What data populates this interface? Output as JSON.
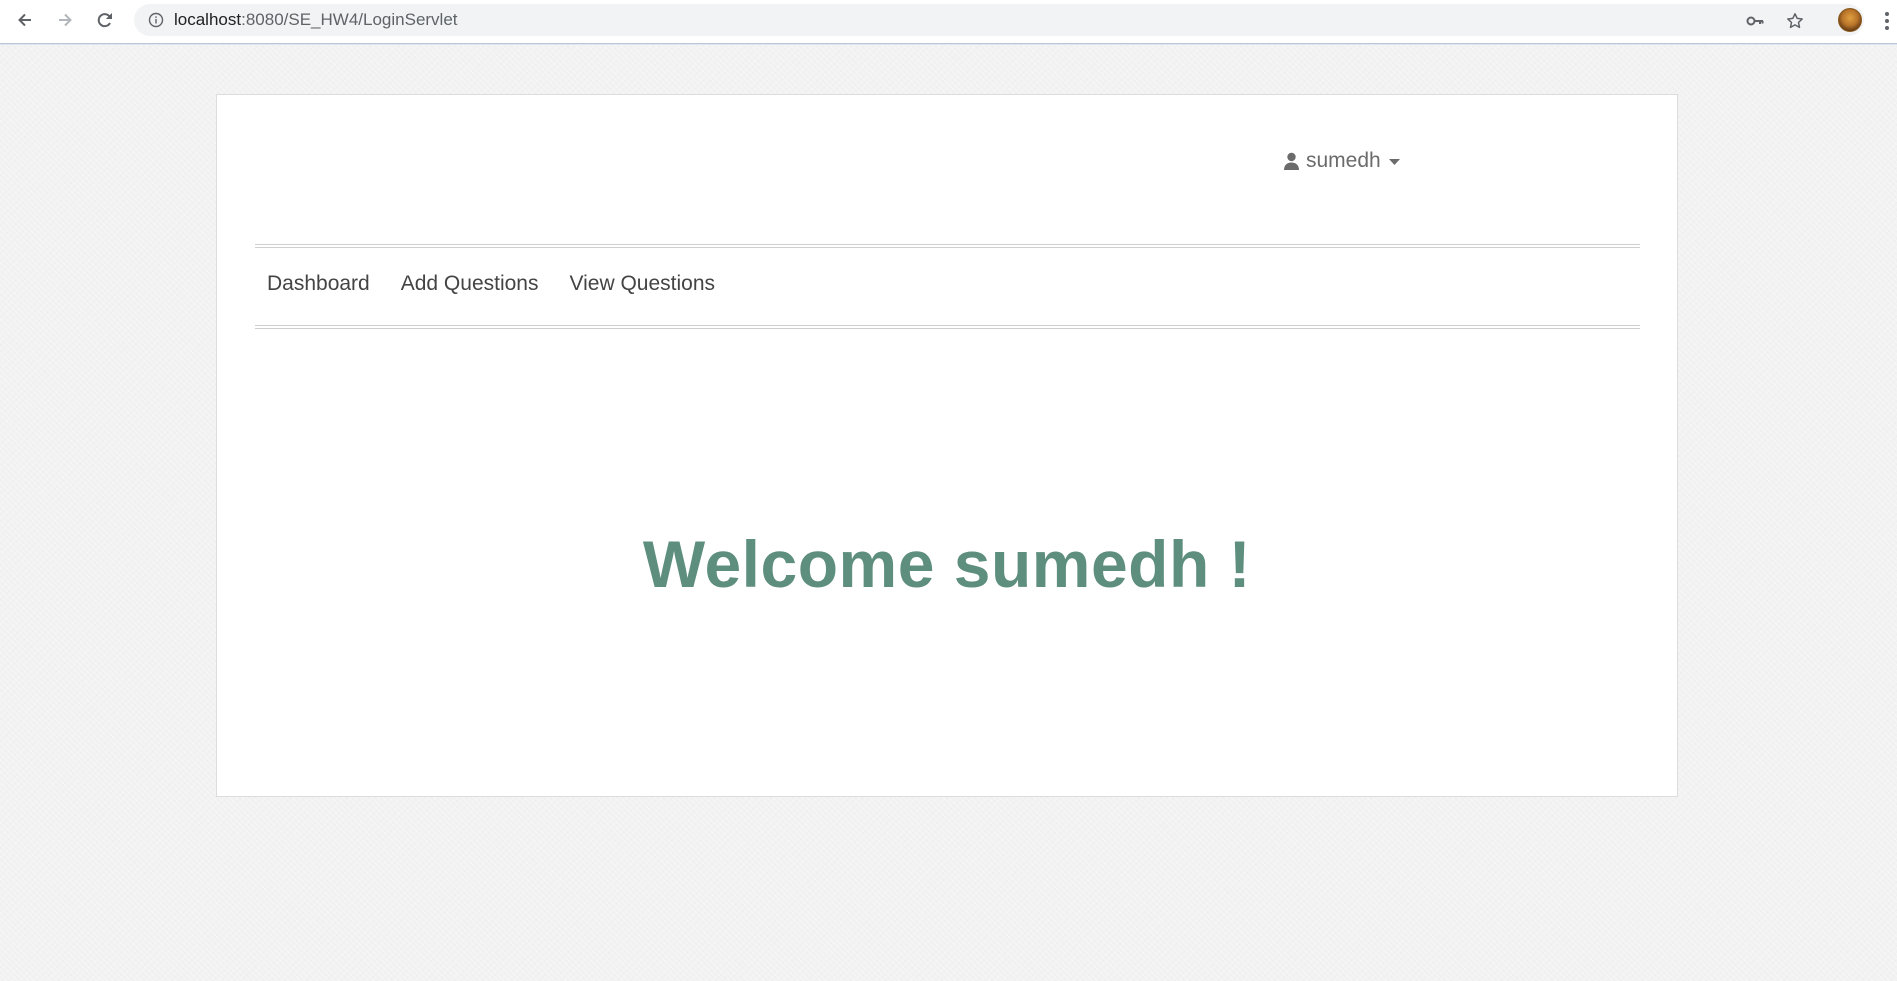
{
  "browser": {
    "url_host": "localhost",
    "url_rest": ":8080/SE_HW4/LoginServlet",
    "icons": [
      "back-arrow-icon",
      "forward-arrow-icon",
      "reload-icon",
      "info-icon",
      "key-icon",
      "star-icon",
      "profile-avatar",
      "more-vert-icon"
    ]
  },
  "user_menu": {
    "username": "sumedh",
    "icon": "user-icon",
    "caret": "caret-down-icon"
  },
  "nav": {
    "items": [
      {
        "label": "Dashboard"
      },
      {
        "label": "Add Questions"
      },
      {
        "label": "View Questions"
      }
    ]
  },
  "main": {
    "welcome_text": "Welcome sumedh !"
  },
  "colors": {
    "heading": "#5e8e7e",
    "nav_text": "#444444",
    "user_text": "#6b6b6b",
    "page_bg": "#f2f2f2"
  }
}
